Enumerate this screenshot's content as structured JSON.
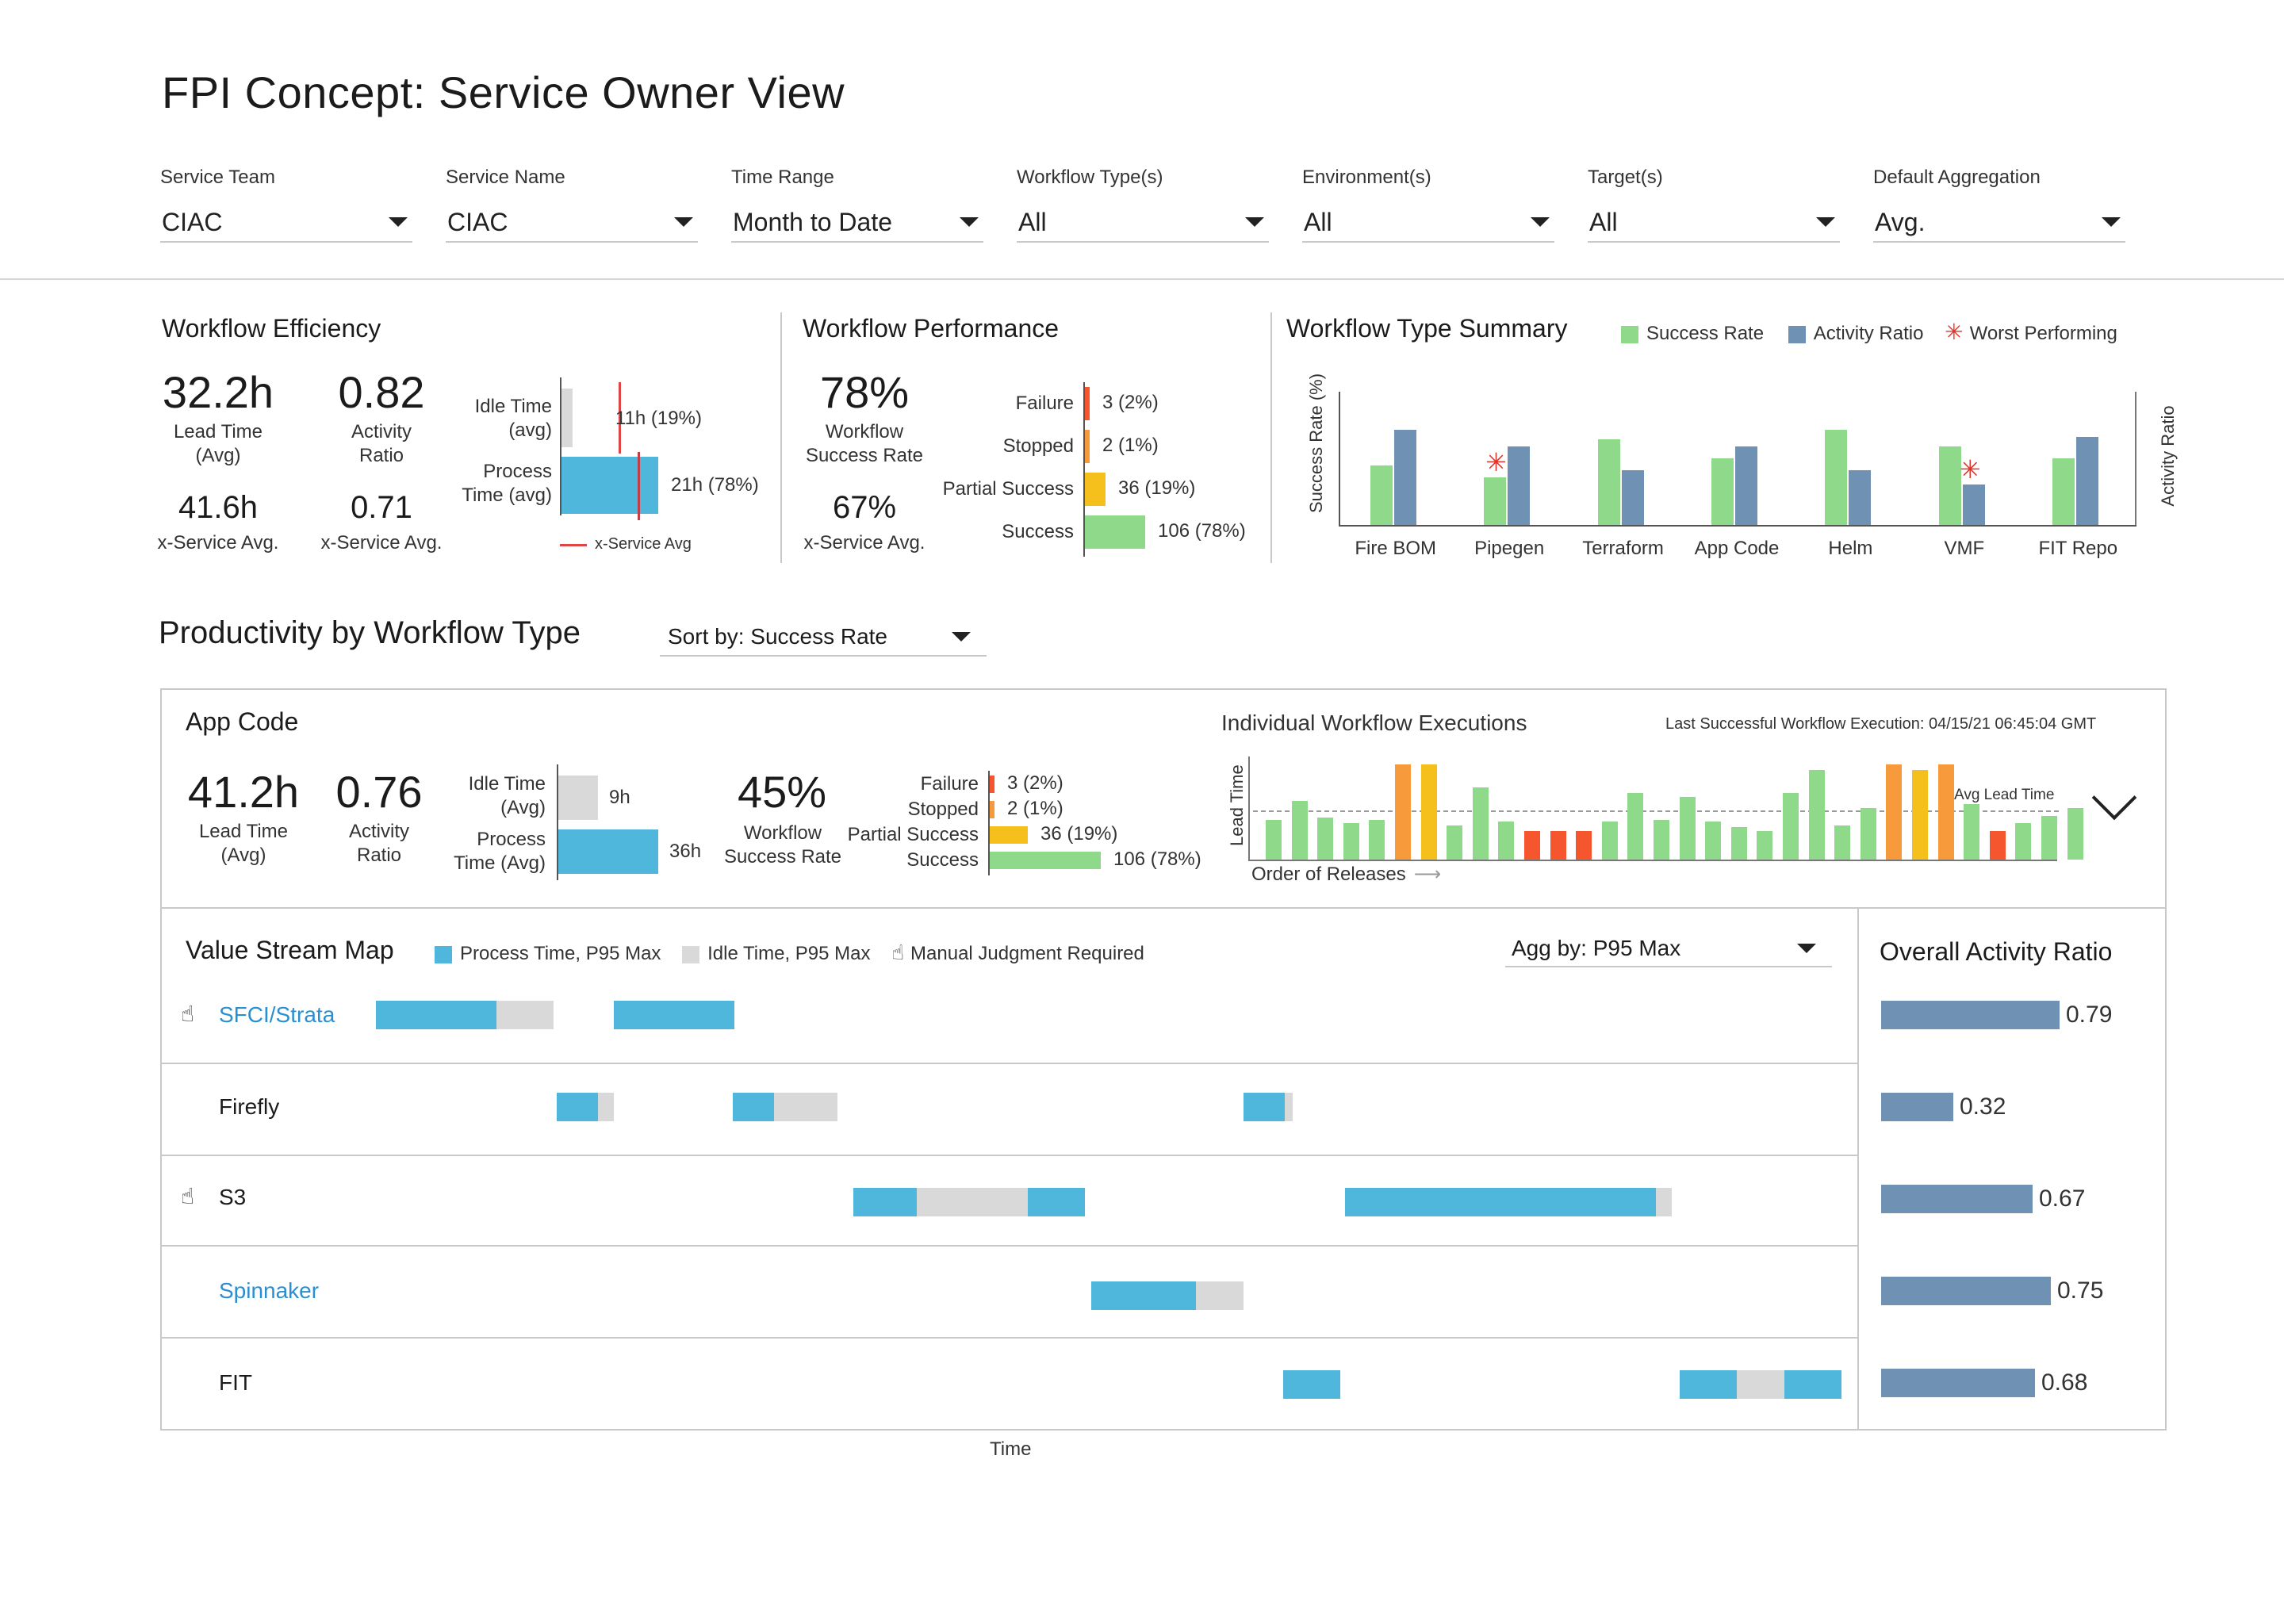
{
  "title": "FPI Concept: Service Owner View",
  "filters": [
    {
      "label": "Service Team",
      "value": "CIAC"
    },
    {
      "label": "Service Name",
      "value": "CIAC"
    },
    {
      "label": "Time Range",
      "value": "Month to Date"
    },
    {
      "label": "Workflow Type(s)",
      "value": "All"
    },
    {
      "label": "Environment(s)",
      "value": "All"
    },
    {
      "label": "Target(s)",
      "value": "All"
    },
    {
      "label": "Default Aggregation",
      "value": "Avg."
    }
  ],
  "efficiency": {
    "title": "Workflow Efficiency",
    "lead_time": "32.2h",
    "lead_time_label": "Lead Time\n(Avg)",
    "activity_ratio": "0.82",
    "activity_ratio_label": "Activity\nRatio",
    "x_lead_time": "41.6h",
    "x_lead_label": "x-Service Avg.",
    "x_activity": "0.71",
    "x_activity_label": "x-Service Avg.",
    "idle_label": "Idle Time\n(avg)",
    "idle_value": "11h (19%)",
    "idle_fraction": 0.19,
    "process_label": "Process\nTime (avg)",
    "process_value": "21h (78%)",
    "process_fraction": 0.78,
    "legend_xservice": "x-Service Avg"
  },
  "performance": {
    "title": "Workflow Performance",
    "rate": "78%",
    "rate_label": "Workflow\nSuccess Rate",
    "x_rate": "67%",
    "x_rate_label": "x-Service Avg.",
    "bars": [
      {
        "label": "Failure",
        "value": "3 (2%)",
        "count": 3,
        "color": "#f5562d"
      },
      {
        "label": "Stopped",
        "value": "2 (1%)",
        "count": 2,
        "color": "#f79a3c"
      },
      {
        "label": "Partial Success",
        "value": "36 (19%)",
        "count": 36,
        "color": "#f6c01c"
      },
      {
        "label": "Success",
        "value": "106 (78%)",
        "count": 106,
        "color": "#8fd98a"
      }
    ]
  },
  "type_summary": {
    "title": "Workflow Type Summary",
    "legend": {
      "success": "Success Rate",
      "activity": "Activity Ratio",
      "worst": "Worst Performing"
    },
    "y_left": "Success Rate (%)",
    "y_right": "Activity Ratio",
    "colors": {
      "success": "#8fd98a",
      "activity": "#6f91b3",
      "worst": "#e0342b"
    }
  },
  "chart_data": {
    "type": "bar",
    "categories": [
      "Fire BOM",
      "Pipegen",
      "Terraform",
      "App Code",
      "Helm",
      "VMF",
      "FIT Repo"
    ],
    "series": [
      {
        "name": "Success Rate",
        "values": [
          50,
          40,
          72,
          56,
          80,
          66,
          56
        ]
      },
      {
        "name": "Activity Ratio",
        "values": [
          80,
          66,
          46,
          66,
          46,
          34,
          74
        ]
      }
    ],
    "worst_performing": [
      "Pipegen",
      "VMF"
    ],
    "ylabel": "Success Rate (%)",
    "y2label": "Activity Ratio"
  },
  "productivity": {
    "title": "Productivity by Workflow Type",
    "sort_label": "Sort by: Success Rate"
  },
  "app_code": {
    "title": "App Code",
    "lead_time": "41.2h",
    "lead_time_label": "Lead Time\n(Avg)",
    "activity_ratio": "0.76",
    "activity_ratio_label": "Activity\nRatio",
    "idle_label": "Idle Time\n(Avg)",
    "idle_value": "9h",
    "process_label": "Process\nTime (Avg)",
    "process_value": "36h",
    "rate": "45%",
    "rate_label": "Workflow\nSuccess Rate",
    "bars": [
      {
        "label": "Failure",
        "value": "3 (2%)",
        "count": 3,
        "color": "#f5562d"
      },
      {
        "label": "Stopped",
        "value": "2 (1%)",
        "count": 2,
        "color": "#f79a3c"
      },
      {
        "label": "Partial Success",
        "value": "36 (19%)",
        "count": 36,
        "color": "#f6c01c"
      },
      {
        "label": "Success",
        "value": "106 (78%)",
        "count": 106,
        "color": "#8fd98a"
      }
    ],
    "executions_title": "Individual Workflow Executions",
    "last_success": "Last Successful Workflow Execution: 04/15/21 06:45:04 GMT",
    "y_label": "Lead Time",
    "x_label": "Order of Releases",
    "avg_label": "Avg Lead Time",
    "avg_level": 0.52,
    "executions": [
      {
        "h": 0.42,
        "s": "success"
      },
      {
        "h": 0.62,
        "s": "success"
      },
      {
        "h": 0.44,
        "s": "success"
      },
      {
        "h": 0.38,
        "s": "success"
      },
      {
        "h": 0.42,
        "s": "success"
      },
      {
        "h": 1.0,
        "s": "stopped"
      },
      {
        "h": 1.0,
        "s": "partial"
      },
      {
        "h": 0.36,
        "s": "success"
      },
      {
        "h": 0.76,
        "s": "success"
      },
      {
        "h": 0.4,
        "s": "success"
      },
      {
        "h": 0.3,
        "s": "failure"
      },
      {
        "h": 0.3,
        "s": "failure"
      },
      {
        "h": 0.3,
        "s": "failure"
      },
      {
        "h": 0.4,
        "s": "success"
      },
      {
        "h": 0.7,
        "s": "success"
      },
      {
        "h": 0.42,
        "s": "success"
      },
      {
        "h": 0.66,
        "s": "success"
      },
      {
        "h": 0.4,
        "s": "success"
      },
      {
        "h": 0.34,
        "s": "success"
      },
      {
        "h": 0.3,
        "s": "success"
      },
      {
        "h": 0.7,
        "s": "success"
      },
      {
        "h": 0.94,
        "s": "success"
      },
      {
        "h": 0.36,
        "s": "success"
      },
      {
        "h": 0.54,
        "s": "success"
      },
      {
        "h": 1.0,
        "s": "stopped"
      },
      {
        "h": 0.94,
        "s": "partial"
      },
      {
        "h": 1.0,
        "s": "stopped"
      },
      {
        "h": 0.58,
        "s": "success"
      },
      {
        "h": 0.3,
        "s": "failure"
      },
      {
        "h": 0.38,
        "s": "success"
      },
      {
        "h": 0.46,
        "s": "success"
      },
      {
        "h": 0.54,
        "s": "success"
      }
    ]
  },
  "vsm": {
    "title": "Value Stream Map",
    "legend_process": "Process Time, P95 Max",
    "legend_idle": "Idle Time, P95 Max",
    "legend_manual": "Manual Judgment Required",
    "agg_label": "Agg by: P95 Max",
    "x_label": "Time",
    "rows": [
      {
        "name": "SFCI/Strata",
        "link": true,
        "manual": true
      },
      {
        "name": "Firefly",
        "link": false,
        "manual": false
      },
      {
        "name": "S3",
        "link": false,
        "manual": true
      },
      {
        "name": "Spinnaker",
        "link": true,
        "manual": false
      },
      {
        "name": "FIT",
        "link": false,
        "manual": false
      }
    ]
  },
  "overall": {
    "title": "Overall Activity Ratio",
    "values": [
      {
        "label": "0.79",
        "v": 0.79
      },
      {
        "label": "0.32",
        "v": 0.32
      },
      {
        "label": "0.67",
        "v": 0.67
      },
      {
        "label": "0.75",
        "v": 0.75
      },
      {
        "label": "0.68",
        "v": 0.68
      }
    ]
  }
}
